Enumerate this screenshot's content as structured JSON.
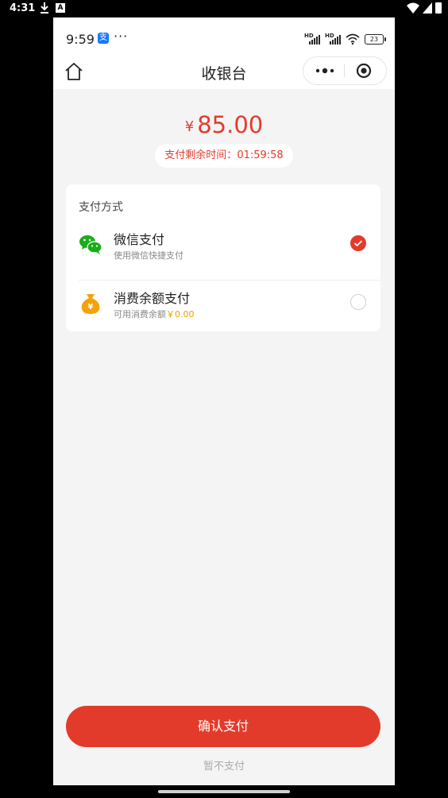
{
  "os_status": {
    "time": "4:31",
    "a_badge": "A"
  },
  "inner_status": {
    "time": "9:59",
    "app_badge": "支",
    "dots": "···",
    "battery": "23",
    "hd1": "HD",
    "hd2": "HD"
  },
  "navbar": {
    "title": "收银台"
  },
  "payment": {
    "currency": "¥",
    "amount": "85.00",
    "timer_label": "支付剩余时间：",
    "timer_value": "01:59:58"
  },
  "methods_card": {
    "title": "支付方式",
    "methods": [
      {
        "name": "微信支付",
        "desc": "使用微信快捷支付",
        "selected": true,
        "icon": "wechat-icon"
      },
      {
        "name": "消费余额支付",
        "desc_prefix": "可用消费余额",
        "balance": "￥0.00",
        "selected": false,
        "icon": "money-bag-icon"
      }
    ]
  },
  "actions": {
    "confirm": "确认支付",
    "skip": "暂不支付"
  },
  "colors": {
    "accent": "#e33b2b",
    "balance": "#e9a300",
    "wechat": "#1aad19"
  }
}
